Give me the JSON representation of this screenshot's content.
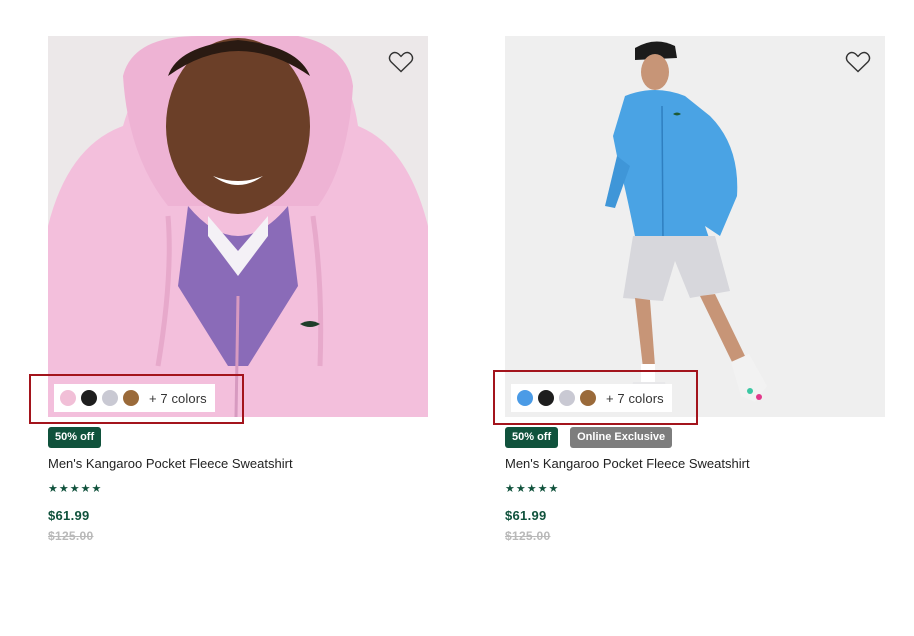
{
  "products": [
    {
      "name": "Men's Kangaroo Pocket Fleece Sweatshirt",
      "badges": [
        "50% off"
      ],
      "rating_stars": 5,
      "price": "$61.99",
      "original_price": "$125.00",
      "more_colors_label": "+ 7 colors",
      "swatch_colors": [
        "#f1bfd7",
        "#1e1e1e",
        "#c9c9d3",
        "#9a6a3a"
      ],
      "image_description_icon": "pink-hoodie-photo"
    },
    {
      "name": "Men's Kangaroo Pocket Fleece Sweatshirt",
      "badges": [
        "50% off",
        "Online Exclusive"
      ],
      "rating_stars": 5,
      "price": "$61.99",
      "original_price": "$125.00",
      "more_colors_label": "+ 7 colors",
      "swatch_colors": [
        "#4b9be6",
        "#1e1e1e",
        "#c9c9d3",
        "#9a6a3a"
      ],
      "image_description_icon": "blue-hoodie-photo"
    }
  ],
  "colors": {
    "brand_green": "#10523c",
    "exclusive_grey": "#7d7d7d",
    "highlight_red": "#a3141c"
  }
}
